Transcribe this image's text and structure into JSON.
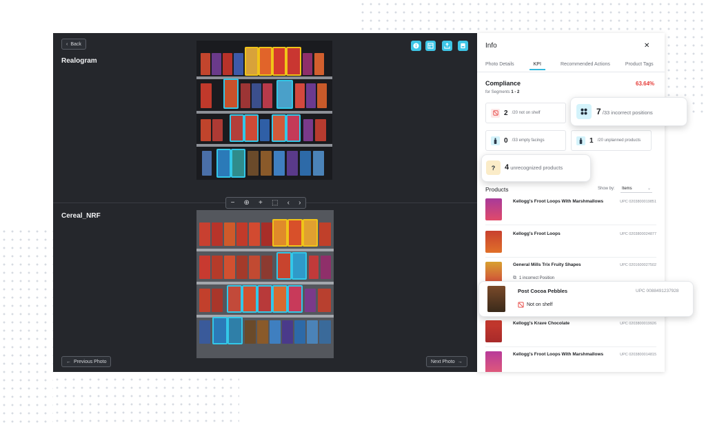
{
  "viewer": {
    "back_label": "Back",
    "realogram_title": "Realogram",
    "planogram_title": "Cereal_NRF",
    "prev_label": "Previous Photo",
    "next_label": "Next Photo",
    "toolbar_icons": [
      "info-icon",
      "layout-icon",
      "upload-icon",
      "save-icon"
    ],
    "zoom_tools": [
      "minus-icon",
      "zoom-icon",
      "plus-icon",
      "select-icon",
      "chevron-left-icon",
      "chevron-right-icon"
    ]
  },
  "panel": {
    "title": "Info",
    "close_label": "✕",
    "tabs": [
      "Photo Details",
      "KPI",
      "Recommended Actions",
      "Product Tags"
    ],
    "active_tab": "KPI",
    "compliance": {
      "title": "Compliance",
      "value": "63.64%",
      "segments_prefix": "for Segments ",
      "segments": "1 - 2"
    },
    "kpis": {
      "not_on_shelf": {
        "count": "2",
        "label": "/20 not on shelf"
      },
      "incorrect_positions": {
        "count": "7",
        "label": "/33 incorrect positions"
      },
      "empty_facings": {
        "count": "0",
        "label": "/33 empty facings"
      },
      "unplanned": {
        "count": "1",
        "label": "/20 unplanned products"
      },
      "unrecognized": {
        "count": "4",
        "label": "unrecognized products"
      }
    },
    "products_title": "Products",
    "show_by_label": "Show by:",
    "show_by_value": "Items",
    "products": [
      {
        "name": "Kellogg's Froot Loops With Marshmallows",
        "upc": "UPC 0203800019851"
      },
      {
        "name": "Kellogg's Froot Loops",
        "upc": "UPC 0203800024877"
      },
      {
        "name": "General Mills Trix Fruity Shapes",
        "upc": "UPC 0201600027502",
        "note": "1 incorrect Position"
      },
      {
        "name": "Post Cocoa Pebbles",
        "upc": "UPC 0088491237928",
        "note": "Not on shelf"
      },
      {
        "name": "Kellogg's Krave Chocolate",
        "upc": "UPC 0203800019926"
      },
      {
        "name": "Kellogg's Froot Loops With Marshmallows",
        "upc": "UPC 0203800014815"
      }
    ]
  },
  "colors": {
    "accent": "#33c8e8",
    "highlight_yellow": "#f0c419",
    "compliance_red": "#e53935",
    "dark_bg": "#25272c"
  }
}
